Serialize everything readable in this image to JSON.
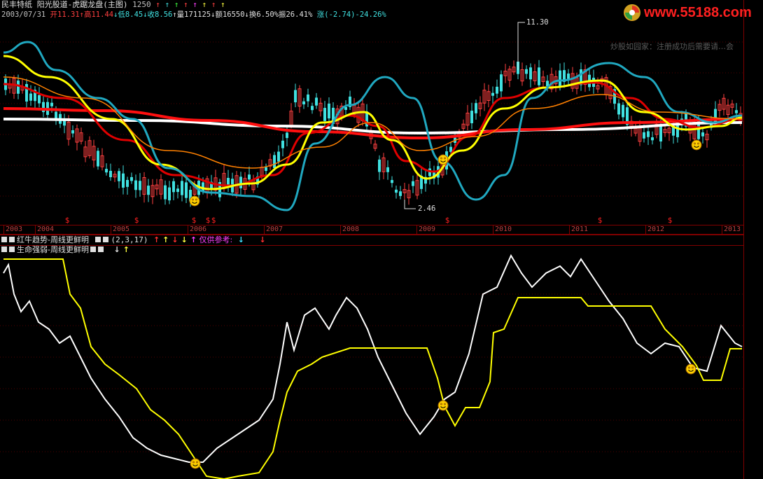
{
  "titlebar": {
    "stock_name": "民丰特纸",
    "indicator_name": "阳光股道-虎踞龙盘(主图)",
    "bar_count": "1250",
    "arrows": [
      "↑",
      "↑",
      "↑",
      "↑",
      "↑",
      "↑",
      "↑",
      "↑"
    ]
  },
  "infobar": {
    "date": "2003/07/31",
    "open_label": "开",
    "open": "11.31",
    "high_label": "高",
    "high": "11.44",
    "low_label": "低",
    "low": "8.45",
    "close_label": "收",
    "close": "8.56",
    "vol_label": "量",
    "vol": "171125",
    "amt_label": "额",
    "amt": "16550",
    "turn_label": "换",
    "turn": "6.50%",
    "amp_label": "振",
    "amp": "26.41%",
    "chg_label": "涨",
    "chg": "(-2.74)-24.26%"
  },
  "logo": {
    "text": "www.55188.com"
  },
  "watermark": "炒股如园家：注册成功后需要请…会",
  "price_labels": {
    "high": "11.30",
    "low": "2.46"
  },
  "years": [
    "2003",
    "2004",
    "2005",
    "2006",
    "2007",
    "2008",
    "2009",
    "2010",
    "2011",
    "2012",
    "2013"
  ],
  "indicator1": {
    "name": "红牛趋势-周线更鲜明",
    "params": "(2,3,17)",
    "note": "仅供参考:"
  },
  "indicator2": {
    "name": "生命强弱-周线更鲜明"
  },
  "colors": {
    "up": "#ff4040",
    "down": "#40e0e0",
    "ma_white": "#ffffff",
    "ma_red": "#ff1010",
    "ma_yellow": "#ffff00",
    "ma_cyan": "#20a8c0",
    "ma_orange": "#ff8000",
    "axis": "#800000"
  }
}
